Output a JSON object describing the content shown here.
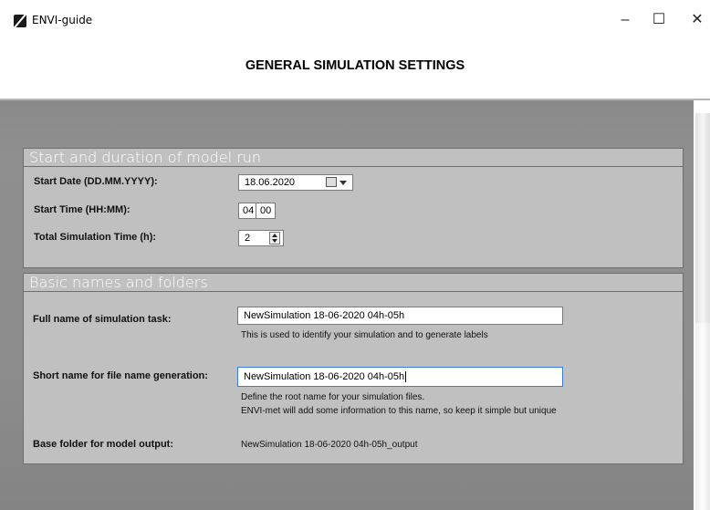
{
  "window": {
    "title": "ENVI-guide",
    "app_icon": "envi-app-icon",
    "controls": {
      "minimize": "–",
      "maximize": "☐",
      "close": "✕"
    }
  },
  "header": {
    "title": "GENERAL SIMULATION SETTINGS"
  },
  "section_run": {
    "title": "Start and duration of model run",
    "start_date": {
      "label": "Start Date (DD.MM.YYYY):",
      "value": "18.06.2020",
      "icon": "calendar-icon"
    },
    "start_time": {
      "label": "Start Time (HH:MM):",
      "hours": "04",
      "minutes": "00"
    },
    "total_time": {
      "label": "Total Simulation Time (h):",
      "value": "2",
      "icon": "spinner-icon"
    }
  },
  "section_names": {
    "title": "Basic names and folders",
    "full_name": {
      "label": "Full name of simulation task:",
      "value": "NewSimulation 18-06-2020 04h-05h",
      "help": "This is used to identify your simulation and to generate labels"
    },
    "short_name": {
      "label": "Short name for file name generation:",
      "value": "NewSimulation 18-06-2020 04h-05h",
      "help_line1": "Define the root name for your simulation files.",
      "help_line2": "ENVI-met will add some information to this name, so keep it simple but unique"
    },
    "base_folder": {
      "label": "Base folder for model output:",
      "value": "NewSimulation 18-06-2020 04h-05h_output"
    }
  },
  "colors": {
    "panel_bg": "#c0c0c0",
    "main_bg": "#8c8c8c",
    "focus_border": "#3b7fd1"
  }
}
